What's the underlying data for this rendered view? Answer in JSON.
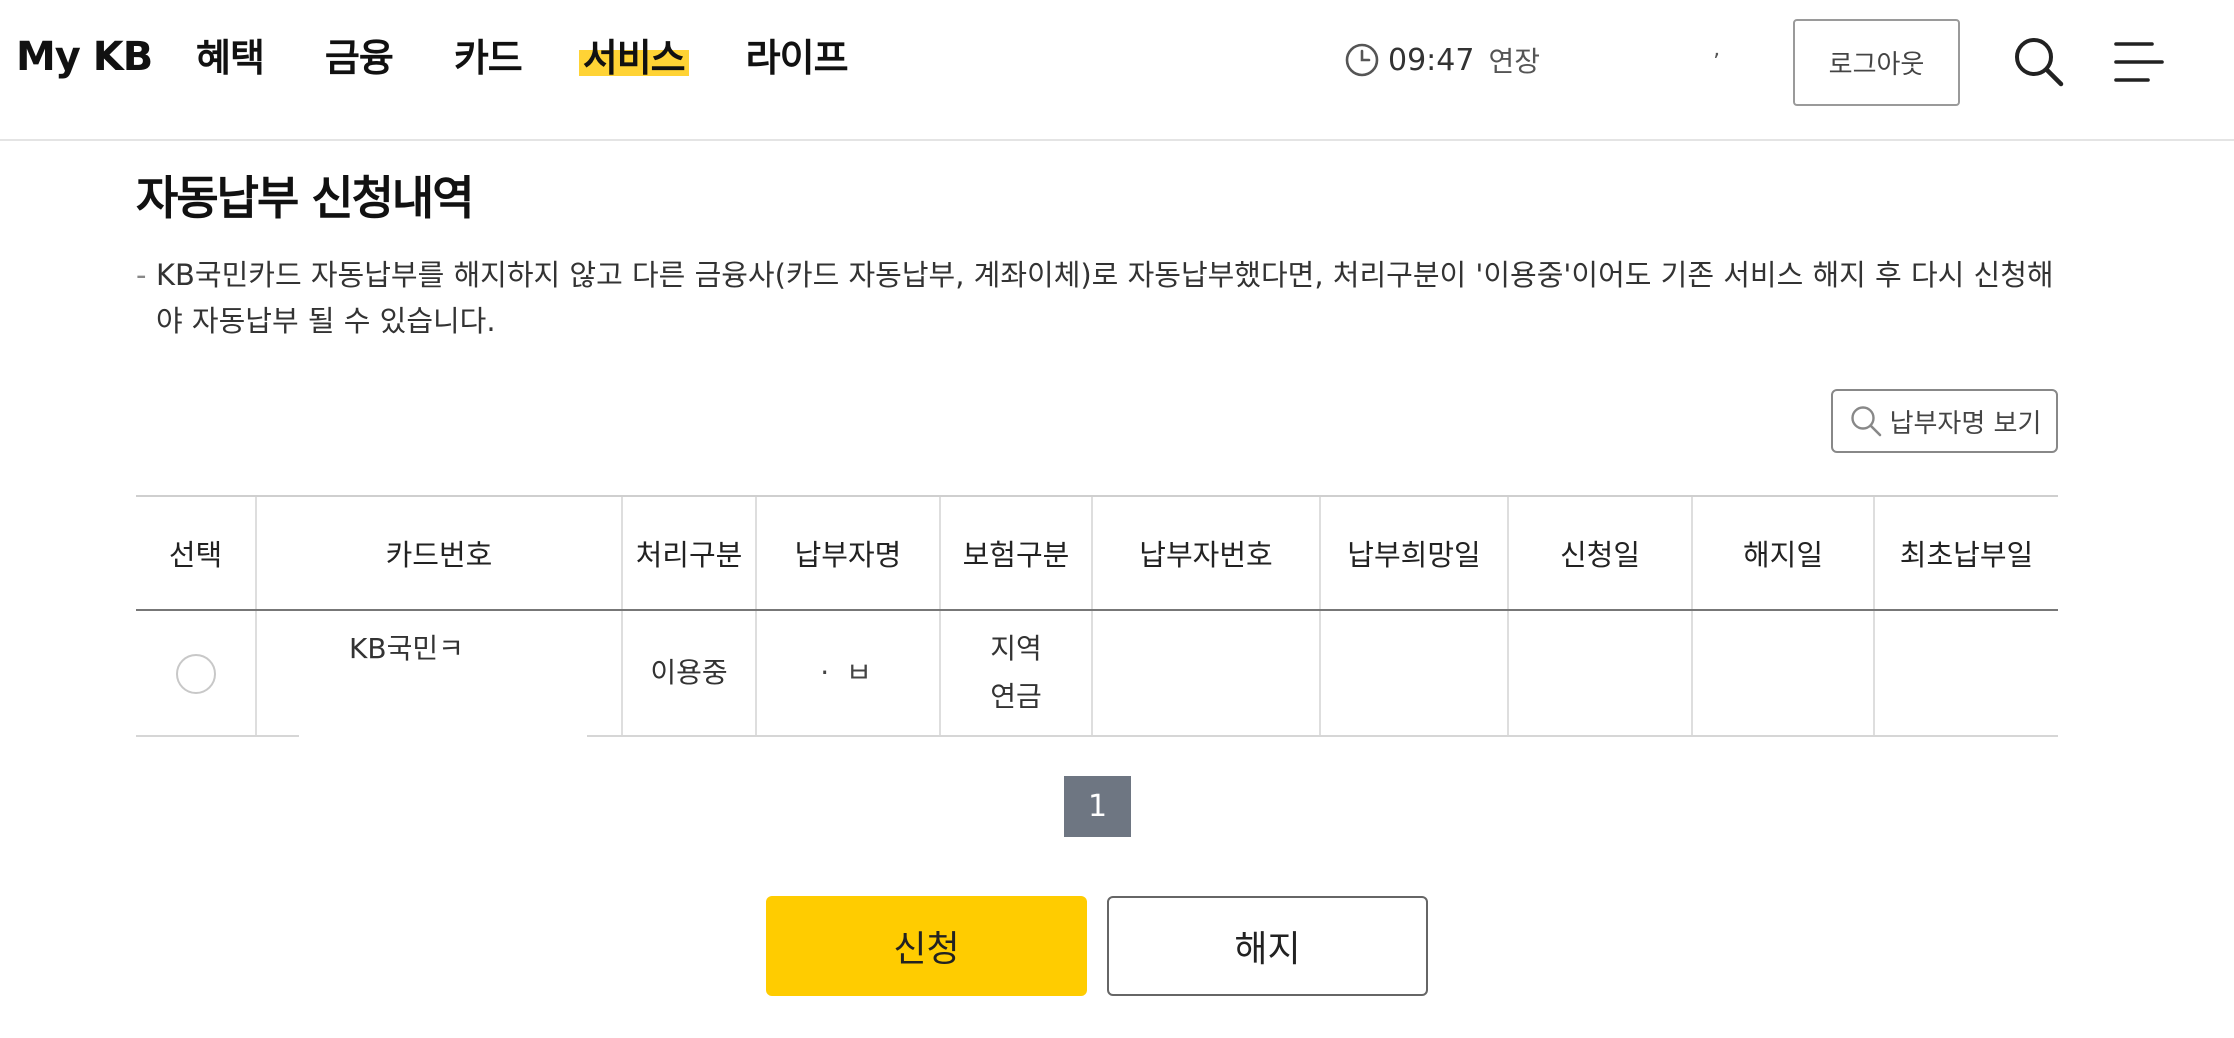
{
  "header": {
    "logo": "My KB",
    "nav": [
      {
        "label": "혜택",
        "active": false
      },
      {
        "label": "금융",
        "active": false
      },
      {
        "label": "카드",
        "active": false
      },
      {
        "label": "서비스",
        "active": true
      },
      {
        "label": "라이프",
        "active": false
      }
    ],
    "timer": {
      "time": "09:47",
      "extend_label": "연장"
    },
    "tick": "ʼ",
    "logout_label": "로그아웃",
    "search_icon": "search-icon",
    "menu_icon": "hamburger-icon"
  },
  "page": {
    "title": "자동납부 신청내역",
    "notice_dash": "-",
    "notice": "KB국민카드 자동납부를 해지하지 않고 다른 금융사(카드 자동납부, 계좌이체)로 자동납부했다면, 처리구분이 '이용중'이어도 기존 서비스 해지 후 다시 신청해야 자동납부 될 수 있습니다.",
    "view_payer_label": "납부자명 보기"
  },
  "table": {
    "columns": [
      "선택",
      "카드번호",
      "처리구분",
      "납부자명",
      "보험구분",
      "납부자번호",
      "납부희망일",
      "신청일",
      "해지일",
      "최초납부일"
    ],
    "rows": [
      {
        "card_number": "KB국민ㅋ",
        "status": "이용중",
        "payer_name": "· ㅂ",
        "insurance_line1": "지역",
        "insurance_line2": "연금",
        "payer_number": "",
        "desired_date": "",
        "apply_date": "",
        "cancel_date": "",
        "first_pay_date": ""
      }
    ]
  },
  "pagination": {
    "current": "1"
  },
  "actions": {
    "apply_label": "신청",
    "cancel_label": "해지"
  },
  "colors": {
    "accent": "#ffcc00",
    "highlight": "#ffd335",
    "page_active": "#6e7682"
  }
}
